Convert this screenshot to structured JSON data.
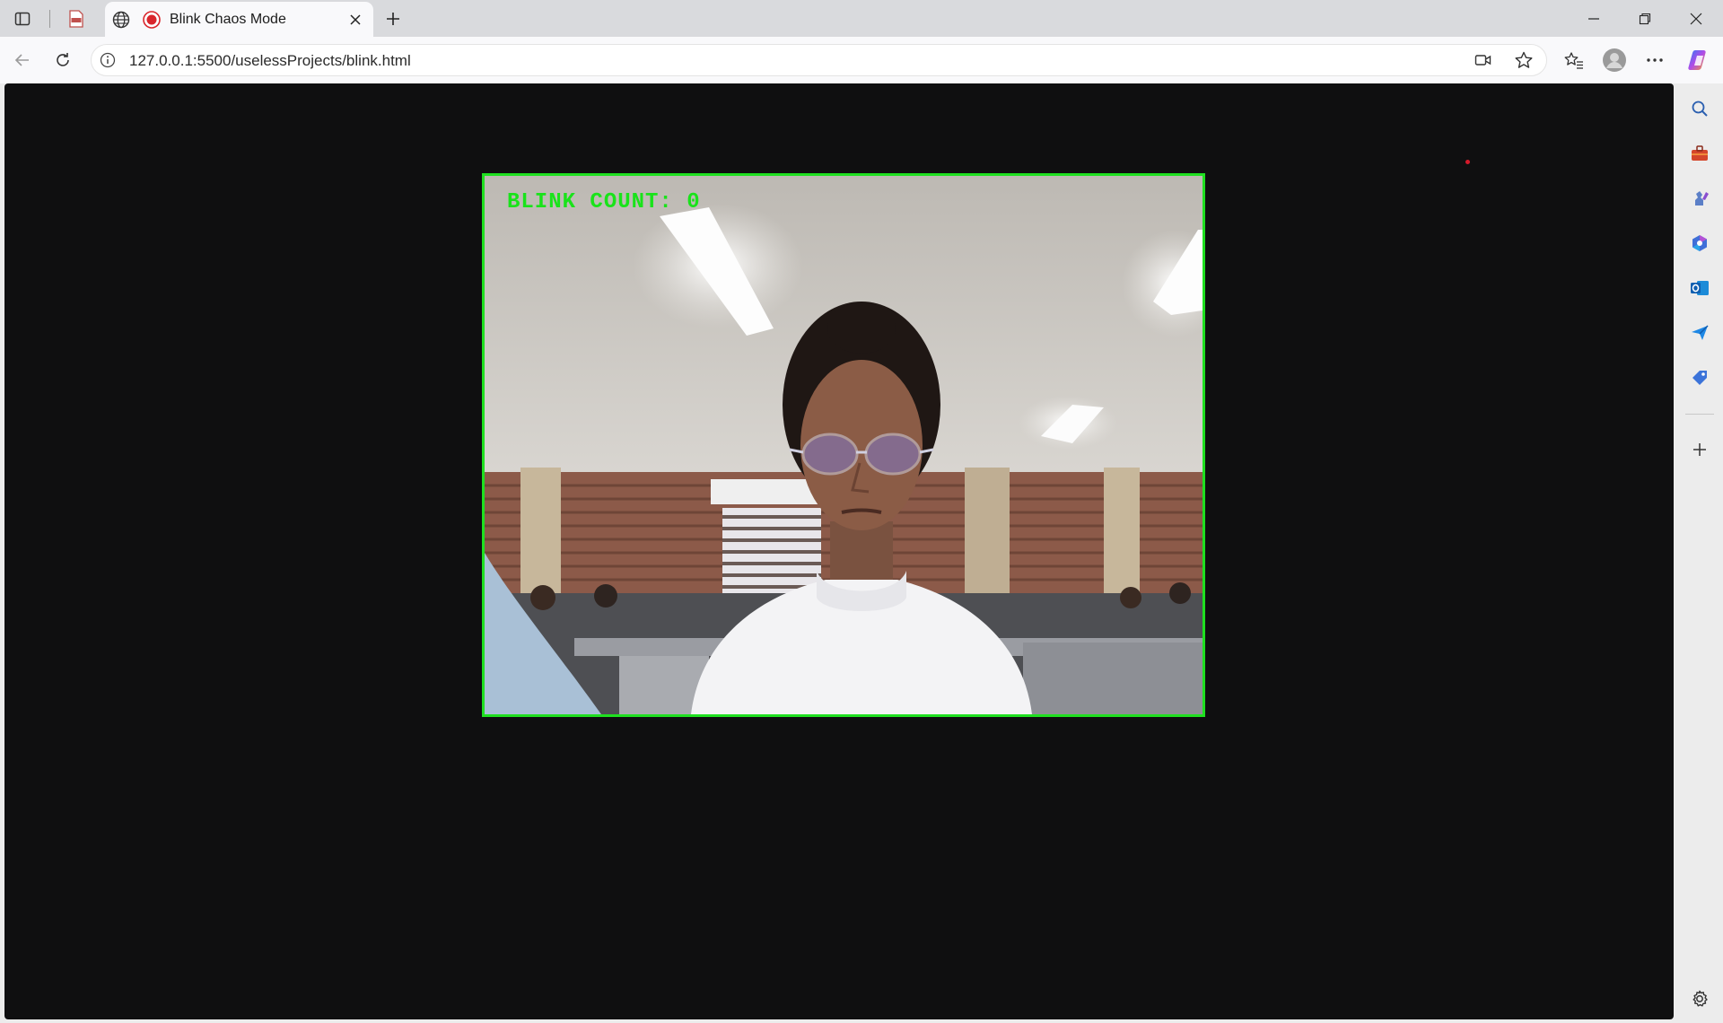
{
  "browser": {
    "tab_title": "Blink Chaos Mode",
    "url": "127.0.0.1:5500/uselessProjects/blink.html"
  },
  "app": {
    "blink_count_text": "BLINK COUNT: 0"
  },
  "colors": {
    "frame_border": "#1fe020",
    "overlay_text": "#19e31a",
    "page_background": "#0f0f10",
    "recording_indicator": "#d9262c"
  },
  "icons": {
    "tabstrip": [
      "sidebar-toggle-icon",
      "pdf-icon",
      "globe-icon",
      "record-icon",
      "close-icon",
      "plus-icon"
    ],
    "window": [
      "minimize-icon",
      "restore-icon",
      "close-window-icon"
    ],
    "toolbar": [
      "back-icon",
      "refresh-icon",
      "info-icon",
      "camera-icon",
      "star-icon",
      "favorites-icon",
      "profile-icon",
      "more-icon",
      "copilot-icon"
    ],
    "sidebar": [
      "search-icon",
      "toolbox-icon",
      "games-icon",
      "microsoft365-icon",
      "outlook-icon",
      "send-icon",
      "tag-icon",
      "plus-icon",
      "settings-icon"
    ]
  }
}
